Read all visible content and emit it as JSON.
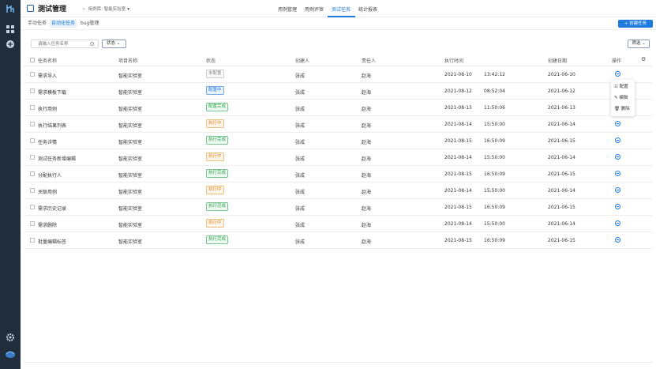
{
  "app": {
    "title": "测试管理"
  },
  "breadcrumb": {
    "sep": ">",
    "project_prefix": "用例库:",
    "project": "智能实验室"
  },
  "top_nav": {
    "items": [
      "用例管理",
      "用例评审",
      "测试任务",
      "统计报表"
    ],
    "active_index": 2
  },
  "sub_tabs": {
    "items": [
      "手动任务",
      "自动化任务",
      "bug管理"
    ],
    "active_index": 1
  },
  "toolbar": {
    "create_label": "+ 创建任务",
    "search_placeholder": "请输入任务名称",
    "status_filter_label": "状态",
    "filter_label": "筛选"
  },
  "table": {
    "headers": [
      "任务名称",
      "项目名称",
      "状态",
      "创建人",
      "责任人",
      "执行时间",
      "创建日期",
      "操作"
    ],
    "rows": [
      {
        "name": "需求导入",
        "project": "智能实验室",
        "status": "未配置",
        "status_color": "gray",
        "creator": "张成",
        "owner": "赵海",
        "exec_date": "2021-08-10",
        "exec_time": "13:42:12",
        "created": "2021-06-10"
      },
      {
        "name": "需求模板下载",
        "project": "智能实验室",
        "status": "配置中",
        "status_color": "blue",
        "creator": "张成",
        "owner": "赵海",
        "exec_date": "2021-08-12",
        "exec_time": "08:52:04",
        "created": "2021-06-12"
      },
      {
        "name": "执行用例",
        "project": "智能实验室",
        "status": "配置完成",
        "status_color": "green",
        "creator": "张成",
        "owner": "赵海",
        "exec_date": "2021-08-13",
        "exec_time": "11:50:06",
        "created": "2021-06-13"
      },
      {
        "name": "执行结果列表",
        "project": "智能实验室",
        "status": "执行中",
        "status_color": "orange",
        "creator": "张成",
        "owner": "赵海",
        "exec_date": "2021-08-14",
        "exec_time": "15:50:00",
        "created": "2021-06-14"
      },
      {
        "name": "任务详情",
        "project": "智能实验室",
        "status": "执行完成",
        "status_color": "green",
        "creator": "张成",
        "owner": "赵海",
        "exec_date": "2021-08-15",
        "exec_time": "16:50:09",
        "created": "2021-06-15"
      },
      {
        "name": "测试任务新增编辑",
        "project": "智能实验室",
        "status": "执行中",
        "status_color": "orange",
        "creator": "张成",
        "owner": "赵海",
        "exec_date": "2021-08-14",
        "exec_time": "15:50:00",
        "created": "2021-06-14"
      },
      {
        "name": "分配执行人",
        "project": "智能实验室",
        "status": "执行完成",
        "status_color": "green",
        "creator": "张成",
        "owner": "赵海",
        "exec_date": "2021-08-15",
        "exec_time": "16:50:09",
        "created": "2021-06-15"
      },
      {
        "name": "关联用例",
        "project": "智能实验室",
        "status": "执行中",
        "status_color": "orange",
        "creator": "张成",
        "owner": "赵海",
        "exec_date": "2021-08-14",
        "exec_time": "15:50:00",
        "created": "2021-06-14"
      },
      {
        "name": "需求历史记录",
        "project": "智能实验室",
        "status": "执行完成",
        "status_color": "green",
        "creator": "张成",
        "owner": "赵海",
        "exec_date": "2021-08-15",
        "exec_time": "16:50:09",
        "created": "2021-06-15"
      },
      {
        "name": "需求删除",
        "project": "智能实验室",
        "status": "执行中",
        "status_color": "orange",
        "creator": "张成",
        "owner": "赵海",
        "exec_date": "2021-08-14",
        "exec_time": "15:50:00",
        "created": "2021-06-14"
      },
      {
        "name": "批量编辑标签",
        "project": "智能实验室",
        "status": "执行完成",
        "status_color": "green",
        "creator": "张成",
        "owner": "赵海",
        "exec_date": "2021-08-15",
        "exec_time": "16:50:09",
        "created": "2021-06-15"
      }
    ]
  },
  "row_menu": {
    "items": [
      "配置",
      "编辑",
      "删除"
    ]
  },
  "colors": {
    "accent": "#1f7ae0",
    "sidebar": "#1f2d3d"
  }
}
